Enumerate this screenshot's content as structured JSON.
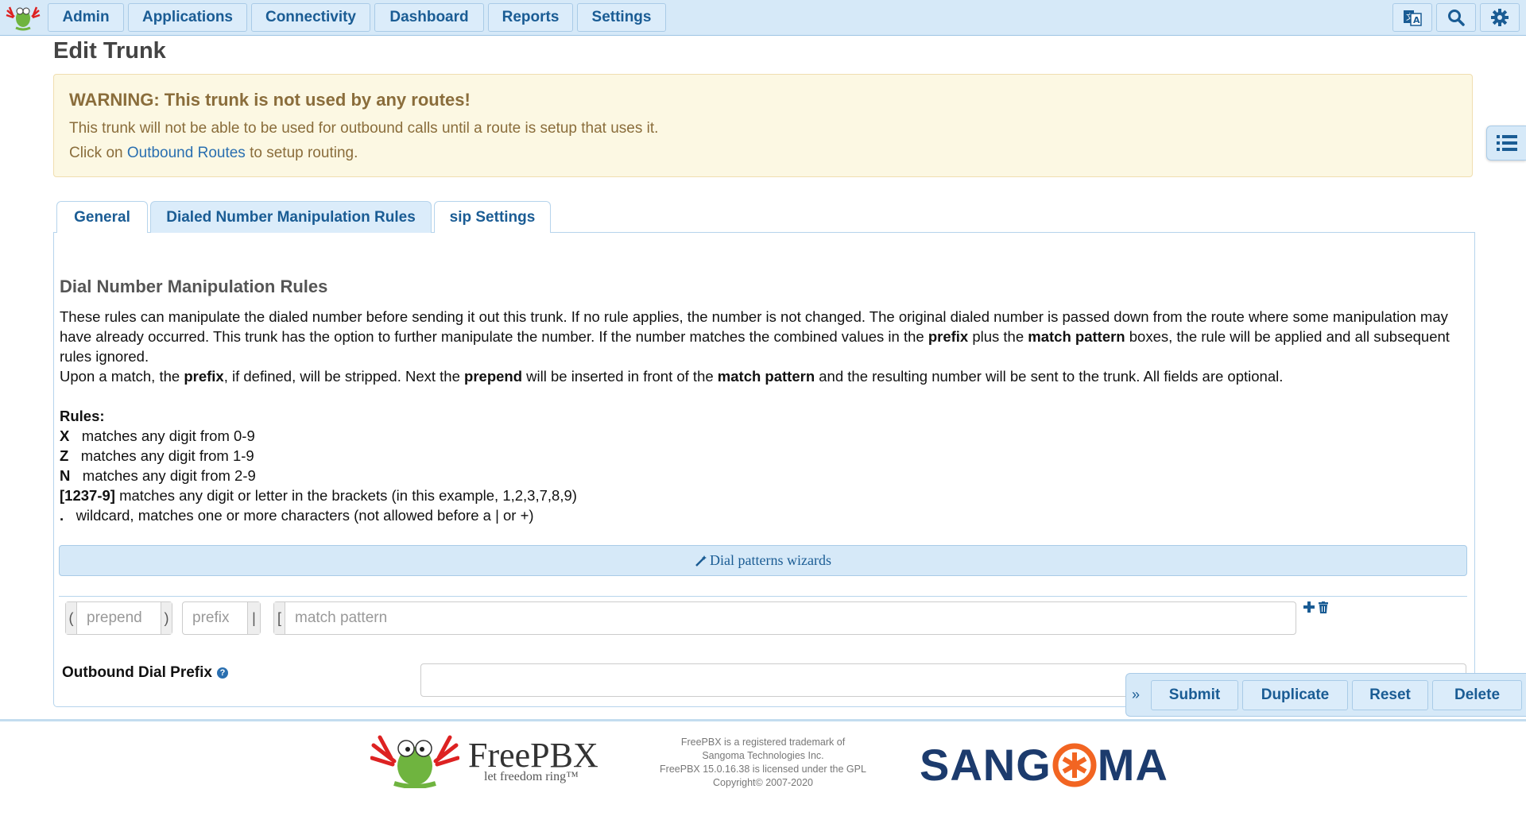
{
  "nav": {
    "items": [
      "Admin",
      "Applications",
      "Connectivity",
      "Dashboard",
      "Reports",
      "Settings"
    ],
    "icons": [
      "language-icon",
      "search-icon",
      "gear-icon"
    ]
  },
  "page_title": "Edit Trunk",
  "warning": {
    "title": "WARNING: This trunk is not used by any routes!",
    "line1": "This trunk will not be able to be used for outbound calls until a route is setup that uses it.",
    "line2_pre": "Click on",
    "line2_link": "Outbound Routes",
    "line2_post": "to setup routing."
  },
  "tabs": [
    "General",
    "Dialed Number Manipulation Rules",
    "sip Settings"
  ],
  "section": {
    "title": "Dial Number Manipulation Rules",
    "p1_a": "These rules can manipulate the dialed number before sending it out this trunk. If no rule applies, the number is not changed. The original dialed number is passed down from the route where some manipulation may have already occurred. This trunk has the option to further manipulate the number. If the number matches the combined values in the",
    "p1_b1": "prefix",
    "p1_c": "plus the",
    "p1_b2": "match pattern",
    "p1_d": "boxes, the rule will be applied and all subsequent rules ignored.",
    "p2_a": "Upon a match, the",
    "p2_b1": "prefix",
    "p2_c": ", if defined, will be stripped. Next the",
    "p2_b2": "prepend",
    "p2_d": "will be inserted in front of the",
    "p2_b3": "match pattern",
    "p2_e": "and the resulting number will be sent to the trunk. All fields are optional.",
    "rules_title": "Rules:",
    "rules": [
      {
        "key": "X",
        "text": "matches any digit from 0-9"
      },
      {
        "key": "Z",
        "text": "matches any digit from 1-9"
      },
      {
        "key": "N",
        "text": "matches any digit from 2-9"
      },
      {
        "key": "[1237-9]",
        "text": "matches any digit or letter in the brackets (in this example, 1,2,3,7,8,9)"
      },
      {
        "key": ".",
        "text": "wildcard, matches one or more characters (not allowed before a | or +)"
      }
    ]
  },
  "wizard_label": "Dial patterns wizards",
  "pattern": {
    "open_paren": "(",
    "prepend_placeholder": "prepend",
    "close_paren": ")",
    "prefix_placeholder": "prefix",
    "pipe": "|",
    "bracket": "[",
    "match_placeholder": "match pattern"
  },
  "outbound_dial_prefix_label": "Outbound Dial Prefix",
  "actions": [
    "Submit",
    "Duplicate",
    "Reset",
    "Delete"
  ],
  "footer": {
    "brand": "FreePBX",
    "tagline": "let freedom ring™",
    "line1": "FreePBX is a registered trademark of",
    "line2": "Sangoma Technologies Inc.",
    "line3": "FreePBX 15.0.16.38 is licensed under the GPL",
    "line4": "Copyright© 2007-2020",
    "sangoma_a": "SANG",
    "sangoma_b": "MA"
  },
  "colors": {
    "nav_bg": "#d6e9f8",
    "link": "#1a5c94",
    "warning_bg": "#fcf8e3",
    "warning_text": "#8a6d3b"
  }
}
